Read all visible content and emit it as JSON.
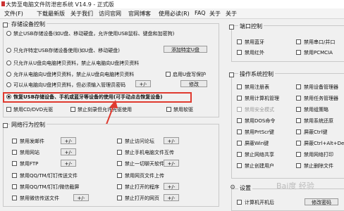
{
  "window": {
    "title": "大势至电脑文件防泄密系统 V14.9 - 正式版"
  },
  "menu": [
    "文件(F)",
    "下载最新版",
    "关于我们",
    "访问官网",
    "官网博客",
    "使用必读(R)",
    "FAQ",
    "关于",
    "关于"
  ],
  "storage": {
    "title": "存储设备控制",
    "options": [
      "禁止USB存储设备(如U盘、移动硬盘，允许使用USB鼠标、键盘和加密狗)",
      "只允许特定USB存储设备使用(如U盘、移动硬盘)",
      "只允许从U盘向电脑拷贝资料，禁止从电脑向U盘拷贝资料",
      "允许从电脑向U盘拷贝资料，禁止从U盘向电脑拷贝资料",
      "可以从电脑向U盘拷贝资料，但必须输入管理员密码",
      "恢复USB存储设备、手机或蓝牙等设备的使用(可手动点击恢复设备)"
    ],
    "add_button": "添加特定U盘",
    "udisk_protect": "启用U盘写保护",
    "modify_button": "修改",
    "plus_button": "+/-",
    "cd_label": "禁用CD/DVD光驱",
    "burn_label": "禁止刻录但允许光驱使用",
    "floppy_label": "禁用软驱"
  },
  "network": {
    "title": "网络行为控制",
    "left": [
      "禁用发邮件",
      "禁用网站",
      "禁用FTP",
      "禁用QQ/TM/钉钉传送文件",
      "禁用QQ/TM/钉钉/微信截屏",
      "禁用微信传送文件"
    ],
    "right": [
      "禁止访问论坛",
      "禁止手机电脑文件互传",
      "禁止一切聊天软件",
      "禁用网页文件上传",
      "禁止打开的程序",
      "禁止打开的网页"
    ],
    "pm": "+/-"
  },
  "port": {
    "title": "端口控制",
    "items": [
      "禁用蓝牙",
      "禁用串口/并口",
      "禁用红外",
      "禁用PCMCIA"
    ]
  },
  "os": {
    "title": "操作系统控制",
    "items": [
      "禁用注册表",
      "禁用设备管理器",
      "禁用计算机管理",
      "禁用任务管理器",
      "禁用安全模式",
      "禁用组策略",
      "禁用DOS命令",
      "禁用系统还原",
      "禁用PrtScr键",
      "屏蔽Ctrl键",
      "屏蔽Win键",
      "屏蔽Ctrl+Alt+Del",
      "禁止网络共享",
      "禁用网络打印",
      "禁止创建用户",
      "禁止删除文件"
    ]
  },
  "settings": {
    "title": "设置",
    "opt1": "计算机开机后",
    "btn": "修改密码"
  },
  "watermark": "Bai度 经验",
  "colors": {
    "highlight": "#e03a2f",
    "bg": "#f0f0f0"
  }
}
